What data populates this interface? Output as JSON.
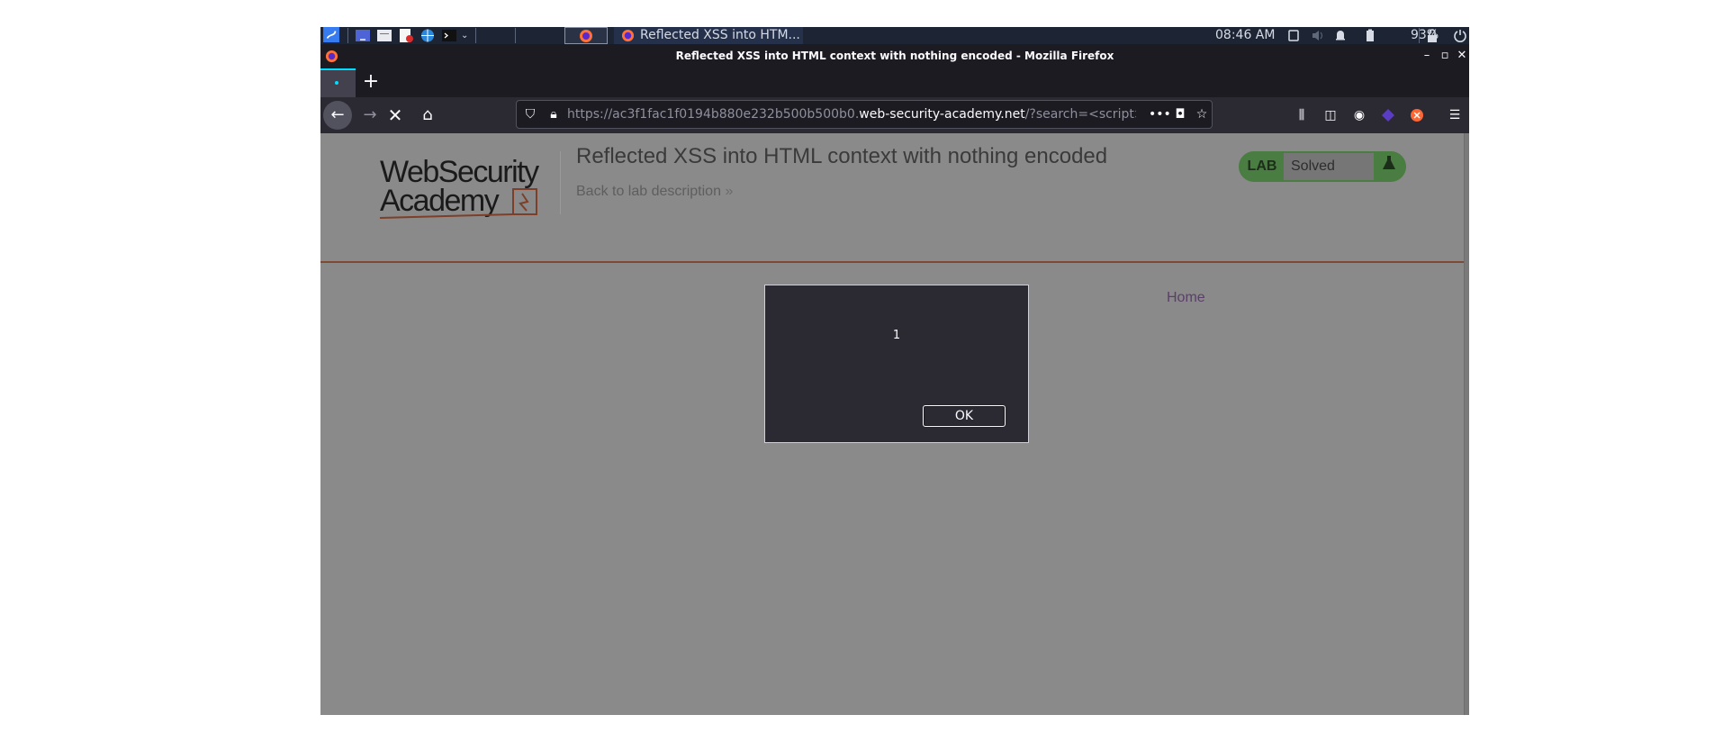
{
  "os_panel": {
    "task_title": "Reflected XSS into HTM...",
    "clock": "08:46 AM",
    "battery": "93%",
    "icons": [
      "kali-menu-icon",
      "desktop-icon",
      "files-icon",
      "text-editor-icon",
      "browser-icon",
      "terminal-icon",
      "chevron-down-icon",
      "firefox-icon",
      "volume-icon",
      "bell-icon",
      "battery-icon",
      "lock-icon",
      "power-icon"
    ]
  },
  "window": {
    "title": "Reflected XSS into HTML context with nothing encoded - Mozilla Firefox"
  },
  "navbar": {
    "url_dim_prefix": "https://ac3f1fac1f0194b880e232b500b500b0.",
    "url_domain": "web-security-academy.net",
    "url_dim_suffix": "/?search=<script>"
  },
  "page": {
    "logo_line1": "WebSecurity",
    "logo_line2": "Academy",
    "lab_title": "Reflected XSS into HTML context with nothing encoded",
    "back_link": "Back to lab description",
    "lab_label": "LAB",
    "lab_state": "Solved",
    "home_link": "Home"
  },
  "alert": {
    "message": "1",
    "ok_label": "OK"
  },
  "colors": {
    "accent": "#00ddff",
    "lab_green": "#4a7d41",
    "brand_orange": "#ff6633"
  }
}
